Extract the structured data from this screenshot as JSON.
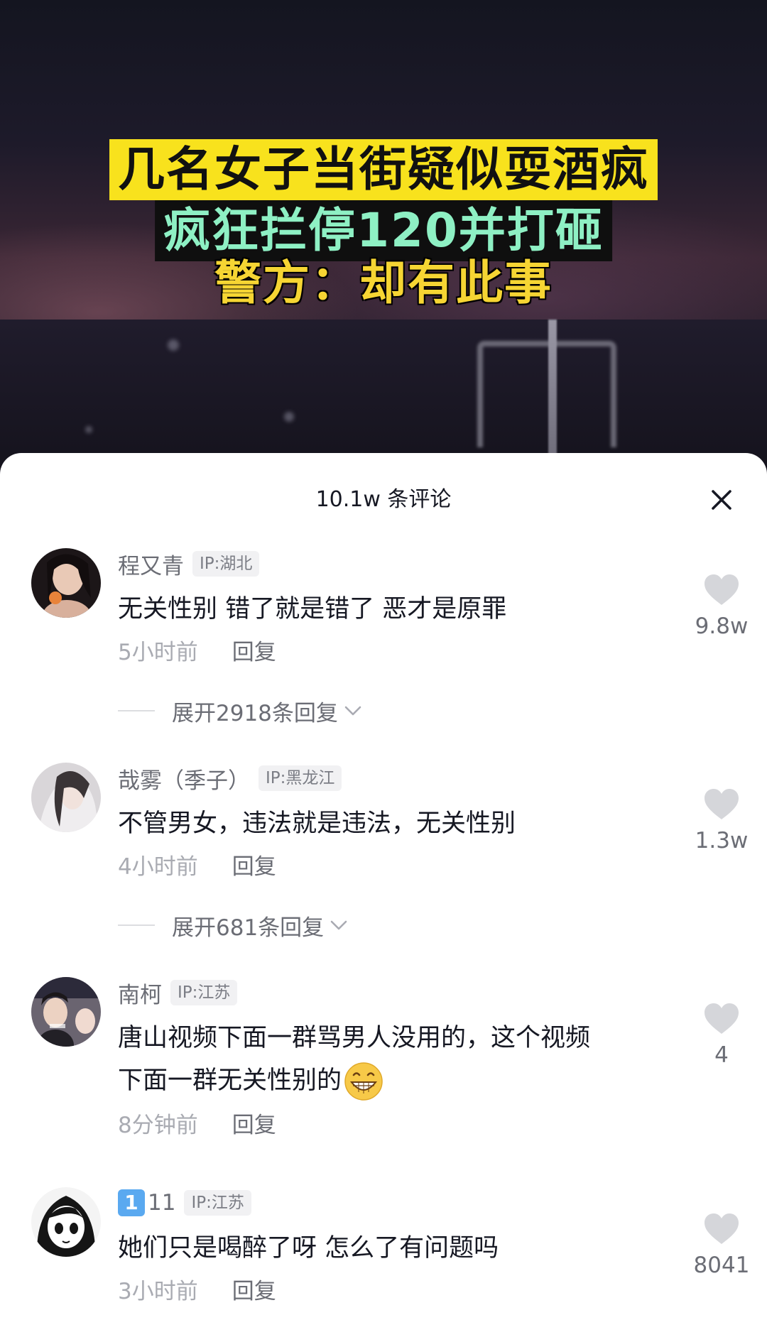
{
  "video": {
    "caption_line1": "几名女子当街疑似耍酒疯",
    "caption_line2": "疯狂拦停120并打砸",
    "caption_line3": "警方：却有此事",
    "caption_colors": {
      "line1_bg": "#f8e21d",
      "line2_text": "#8ef0c4",
      "line3_text": "#f6d533"
    }
  },
  "sheet": {
    "comment_count": "10.1w 条评论",
    "close_icon": "close-icon"
  },
  "comments": [
    {
      "username": "程又青",
      "ip": "IP:湖北",
      "text": "无关性别 错了就是错了 恶才是原罪",
      "time": "5小时前",
      "reply": "回复",
      "expand": "展开2918条回复",
      "likes": "9.8w"
    },
    {
      "username": "哉雾（季子）",
      "ip": "IP:黑龙江",
      "text": "不管男女，违法就是违法，无关性别",
      "time": "4小时前",
      "reply": "回复",
      "expand": "展开681条回复",
      "likes": "1.3w"
    },
    {
      "username": "南柯",
      "ip": "IP:江苏",
      "text_line1": "唐山视频下面一群骂男人没用的，这个视频",
      "text_line2": "下面一群无关性别的",
      "time": "8分钟前",
      "reply": "回复",
      "likes": "4"
    },
    {
      "username_badge": "1",
      "username": "11",
      "ip": "IP:江苏",
      "text": "她们只是喝醉了呀 怎么了有问题吗",
      "time": "3小时前",
      "reply": "回复",
      "likes": "8041"
    }
  ]
}
